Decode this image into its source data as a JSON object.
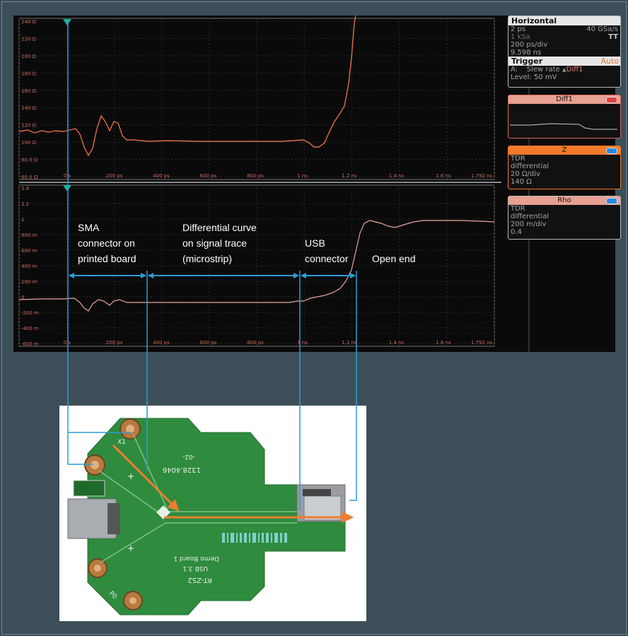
{
  "top_plot": {
    "y_ticks": [
      "240 Ω",
      "220 Ω",
      "200 Ω",
      "180 Ω",
      "160 Ω",
      "140 Ω",
      "120 Ω",
      "100 Ω",
      "80.0 Ω",
      "60.0 Ω"
    ],
    "x_ticks": [
      "0 s",
      "200 ps",
      "400 ps",
      "600 ps",
      "800 ps",
      "1 ns",
      "1.2 ns",
      "1.4 ns",
      "1.6 ns",
      "1.792 ns"
    ]
  },
  "bottom_plot": {
    "y_ticks": [
      "1.4",
      "1.2",
      "1",
      "800 m",
      "600 m",
      "400 m",
      "200 m",
      "0",
      "-200 m",
      "-400 m",
      "-600 m"
    ],
    "x_ticks": [
      "0 s",
      "200 ps",
      "400 ps",
      "600 ps",
      "800 ps",
      "1 ns",
      "1.2 ns",
      "1.4 ns",
      "1.6 ns",
      "1.792 ns"
    ]
  },
  "horizontal_panel": {
    "title": "Horizontal",
    "rows": [
      {
        "left": "2 ps",
        "right": "40 GSa/s"
      },
      {
        "left": "1 kSa",
        "right": "TT"
      },
      {
        "left": "200 ps/div",
        "right": ""
      },
      {
        "left": "9.598 ns",
        "right": ""
      }
    ],
    "trigger_title": "Trigger",
    "trigger_mode": "Auto",
    "trigger_source": "A:",
    "trigger_type": "Slew rate",
    "trigger_channel": "Diff1",
    "trigger_level": "Level: 50 mV"
  },
  "diff1_panel": {
    "title": "Diff1"
  },
  "z_panel": {
    "title": "Z",
    "lines": [
      "TDR",
      "differential",
      "20 Ω/div",
      "140 Ω"
    ]
  },
  "rho_panel": {
    "title": "Rho",
    "lines": [
      "TDR",
      "differential",
      "200 m/div",
      "0.4"
    ]
  },
  "annotations": {
    "sma": [
      "SMA",
      "connector on",
      "printed board"
    ],
    "differential": [
      "Differential curve",
      "on signal trace",
      "(microstrip)"
    ],
    "usb": [
      "USB",
      "connector"
    ],
    "open_end": "Open end"
  },
  "board": {
    "silk_x1": "X1",
    "silk_x2": "X2",
    "silk_code": "1328.4046",
    "silk_rev": "-02-",
    "silk_name": "RT-ZS2",
    "silk_usb": "USB 3.1",
    "silk_demo": "Demo Board 1",
    "silk_po": "P0",
    "silk_p1": "P1"
  },
  "colors": {
    "background": "#3c4f58",
    "trace": "#e06c4a",
    "arrow_blue": "#2e9bd6",
    "arrow_orange": "#f07d2e",
    "pcb_green": "#2f8c3e"
  }
}
